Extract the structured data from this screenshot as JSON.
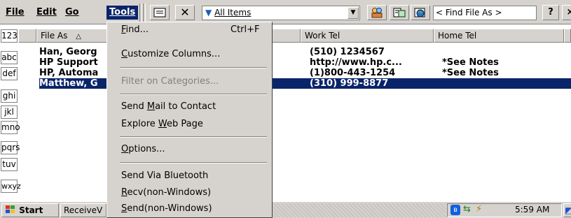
{
  "menubar": {
    "file": "File",
    "edit": "Edit",
    "go": "Go",
    "tools": "Tools"
  },
  "toolbar": {
    "filter_label": "All Items",
    "find_placeholder": "< Find File As >",
    "help_label": "?",
    "close_label": "×"
  },
  "index_tabs": [
    "123",
    "abc",
    "def",
    "ghi",
    "jkl",
    "mno",
    "pqrs",
    "tuv",
    "wxyz"
  ],
  "columns": {
    "file_as": "File As",
    "work_tel": "Work Tel",
    "home_tel": "Home Tel"
  },
  "contacts": [
    {
      "file_as": "Han, Georg",
      "work_tel": "(510) 1234567",
      "home_tel": ""
    },
    {
      "file_as": "HP Support",
      "work_tel": "http://www.hp.c...",
      "home_tel": "*See Notes"
    },
    {
      "file_as": "HP, Automa",
      "work_tel": "(1)800-443-1254",
      "home_tel": "*See Notes"
    },
    {
      "file_as": "Matthew, G",
      "work_tel": "(310) 999-8877",
      "home_tel": "",
      "selected": true
    }
  ],
  "tools_menu": {
    "find": {
      "pre": "",
      "u": "F",
      "post": "ind...",
      "shortcut": "Ctrl+F"
    },
    "customize": {
      "pre": "",
      "u": "C",
      "post": "ustomize Columns..."
    },
    "filter": "Filter on Categories...",
    "send_mail": {
      "pre": "Send ",
      "u": "M",
      "post": "ail to Contact"
    },
    "explore": {
      "pre": "Explore ",
      "u": "W",
      "post": "eb Page"
    },
    "options": {
      "pre": "",
      "u": "O",
      "post": "ptions..."
    },
    "bluetooth": "Send Via Bluetooth",
    "recv": {
      "pre": "",
      "u": "R",
      "post": "ecv(non-Windows)"
    },
    "send": {
      "pre": "",
      "u": "S",
      "post": "end(non-Windows)"
    }
  },
  "taskbar": {
    "start": "Start",
    "task": "ReceiveV",
    "clock": "5:59 AM"
  }
}
